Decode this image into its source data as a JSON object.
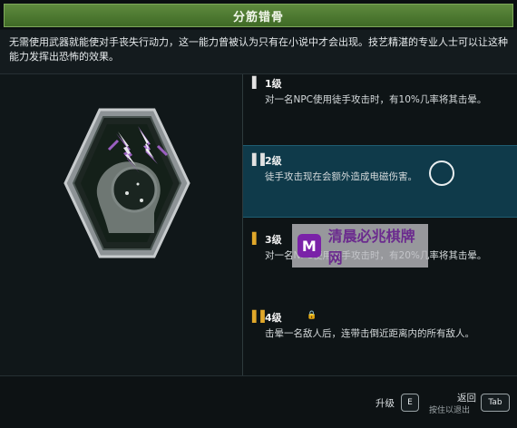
{
  "header": {
    "title": "分筋错骨"
  },
  "description": "无需使用武器就能使对手丧失行动力，这一能力曾被认为只有在小说中才会出现。技艺精湛的专业人士可以让这种能力发挥出恐怖的效果。",
  "tiers": [
    {
      "level": "1级",
      "text": "对一名NPC使用徒手攻击时，有10%几率将其击晕。",
      "marker": "▌",
      "marker_color": "#e2e2e2"
    },
    {
      "level": "2级",
      "text": "徒手攻击现在会额外造成电磁伤害。",
      "marker": "▌▌",
      "marker_color": "#e2e2e2"
    },
    {
      "level": "3级",
      "text": "对一名NPC使用徒手攻击时，有20%几率将其击晕。",
      "marker": "▌",
      "marker_color": "#e0a72a"
    },
    {
      "level": "4级",
      "text": "击晕一名敌人后，连带击倒近距离内的所有敌人。",
      "marker": "▌▌",
      "marker_color": "#e0a72a",
      "locked": true
    }
  ],
  "footer": {
    "upgrade_label": "升级",
    "upgrade_key": "E",
    "back_label": "返回",
    "back_sub": "按住以退出",
    "back_key": "Tab"
  },
  "watermark": {
    "text": "清晨必兆棋牌网",
    "logo": "M"
  },
  "colors": {
    "title_band": "#4e7a33",
    "active_row": "#0f3a4a",
    "accent_gold": "#e0a72a"
  }
}
